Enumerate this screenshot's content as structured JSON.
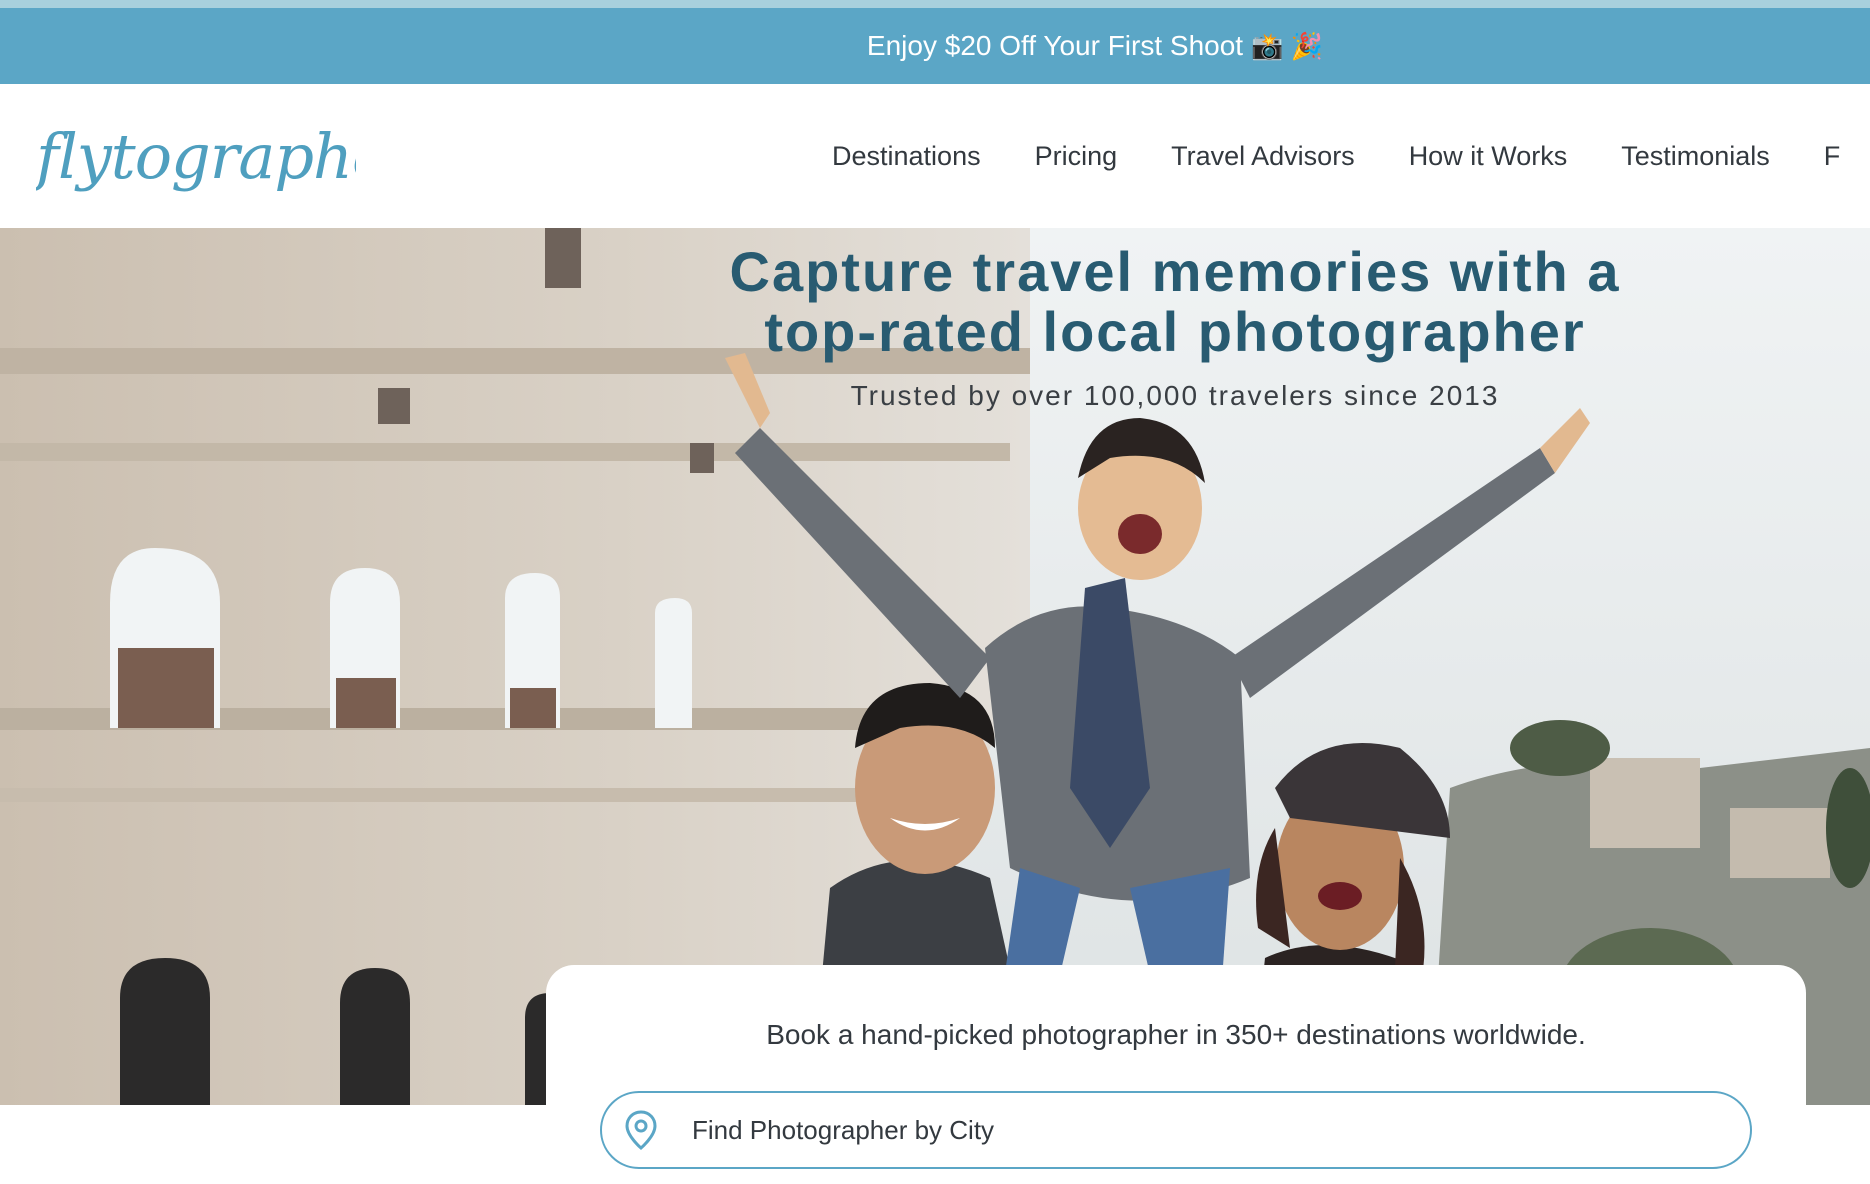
{
  "promo": {
    "text": "Enjoy $20 Off Your First Shoot",
    "emoji": "📸 🎉"
  },
  "header": {
    "logo_text": "flytographer",
    "nav": [
      {
        "label": "Destinations"
      },
      {
        "label": "Pricing"
      },
      {
        "label": "Travel Advisors"
      },
      {
        "label": "How it Works"
      },
      {
        "label": "Testimonials"
      },
      {
        "label": "F"
      }
    ]
  },
  "hero": {
    "headline_line1": "Capture travel memories with a",
    "headline_line2": "top-rated local photographer",
    "subline": "Trusted by over 100,000 travelers since 2013"
  },
  "booking": {
    "text": "Book a hand-picked photographer in 350+ destinations worldwide.",
    "search_placeholder": "Find Photographer by City",
    "search_icon": "location-pin-icon"
  },
  "colors": {
    "brand_blue": "#5ba6c6",
    "headline": "#285b71",
    "text": "#33393f"
  }
}
